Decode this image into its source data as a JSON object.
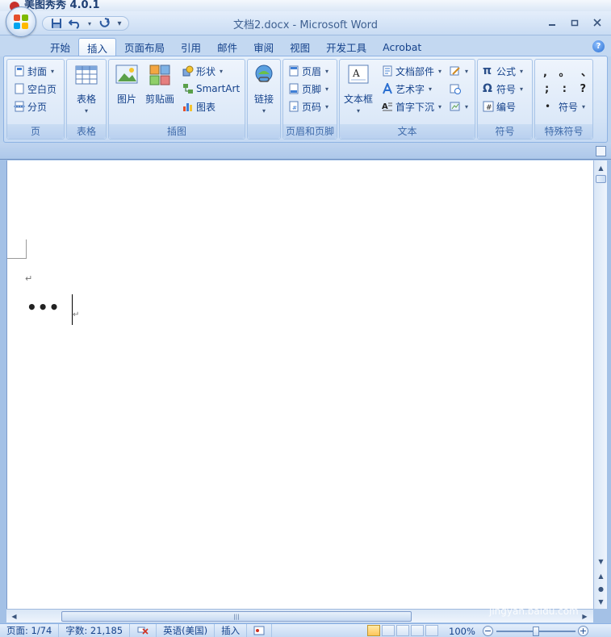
{
  "top_strip": {
    "title": "美图秀秀 4.0.1"
  },
  "window": {
    "title": "文档2.docx - Microsoft Word"
  },
  "qat": {
    "more_label": "▾"
  },
  "tabs": [
    {
      "label": "开始"
    },
    {
      "label": "插入"
    },
    {
      "label": "页面布局"
    },
    {
      "label": "引用"
    },
    {
      "label": "邮件"
    },
    {
      "label": "审阅"
    },
    {
      "label": "视图"
    },
    {
      "label": "开发工具"
    },
    {
      "label": "Acrobat"
    }
  ],
  "help": {
    "label": "?"
  },
  "ribbon": {
    "pages": {
      "label": "页",
      "cover": "封面",
      "blank": "空白页",
      "break": "分页"
    },
    "tables": {
      "label": "表格",
      "table": "表格"
    },
    "illustrations": {
      "label": "插图",
      "picture": "图片",
      "clipart": "剪贴画",
      "shapes": "形状",
      "smartart": "SmartArt",
      "chart": "图表"
    },
    "links": {
      "label": "",
      "link": "链接"
    },
    "header_footer": {
      "label": "页眉和页脚",
      "header": "页眉",
      "footer": "页脚",
      "pagenum": "页码"
    },
    "text": {
      "label": "文本",
      "textbox": "文本框",
      "quickparts": "文档部件",
      "wordart": "艺术字",
      "dropcap": "首字下沉"
    },
    "symbols": {
      "label": "符号",
      "equation": "公式",
      "symbol": "符号",
      "number": "编号"
    },
    "special": {
      "label": "特殊符号",
      "marks_row1": ", 。 、",
      "marks_row2": "; : ?",
      "symbol": "符号"
    }
  },
  "document": {
    "para_mark": "↵",
    "text": "•••",
    "para_mark2": "↵"
  },
  "hscroll": {
    "grip": "|||"
  },
  "watermark": {
    "brand": "Bai du 经验",
    "url": "jingyan.baidu.com"
  },
  "statusbar": {
    "page": "页面: 1/74",
    "words": "字数: 21,185",
    "language": "英语(美国)",
    "mode": "插入",
    "zoom": "100%"
  }
}
